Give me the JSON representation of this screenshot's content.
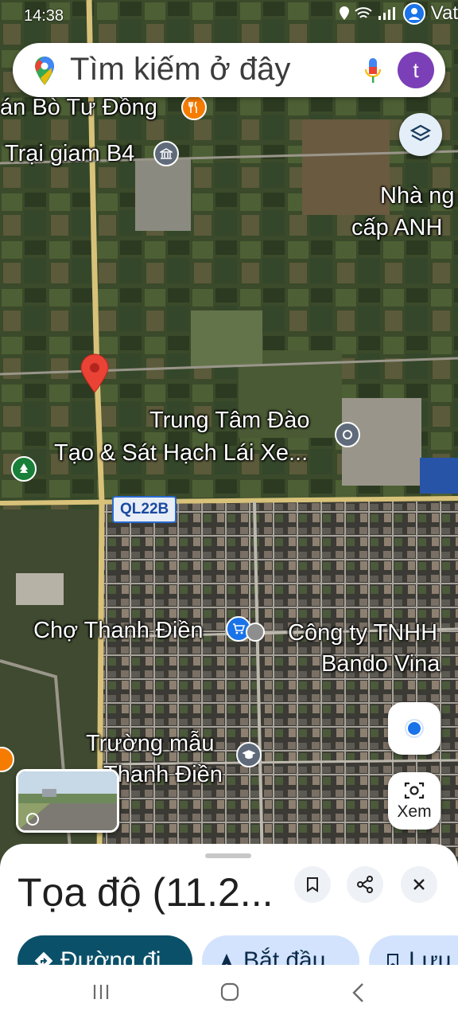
{
  "status_bar": {
    "time": "14:38",
    "carrier": "Vat"
  },
  "search": {
    "placeholder": "Tìm kiếm ở đây",
    "avatar_letter": "t"
  },
  "map": {
    "labels": {
      "restaurant": "án Bò Tư Đồng",
      "prison": "Trại giam B4",
      "house_line1": "Nhà ng",
      "house_line2": "cấp ANH",
      "training_line1": "Trung Tâm Đào",
      "training_line2": "Tạo & Sát Hạch Lái Xe...",
      "road": "QL22B",
      "market": "Chợ Thanh Điền",
      "company_line1": "Công ty TNHH",
      "company_line2": "Bando Vina",
      "school_line1": "Trường mẫu",
      "school_line2": "Thanh Điền"
    },
    "view_button_label": "Xem"
  },
  "place": {
    "title": "Tọa độ (11.2...",
    "actions": {
      "directions": "Đường đi",
      "start": "Bắt đầu",
      "save": "Lưu"
    }
  },
  "colors": {
    "accent": "#0b57d0",
    "pin_red": "#ea4335",
    "directions_chip": "#0b5069",
    "tonal_chip": "#d3e3fd"
  }
}
